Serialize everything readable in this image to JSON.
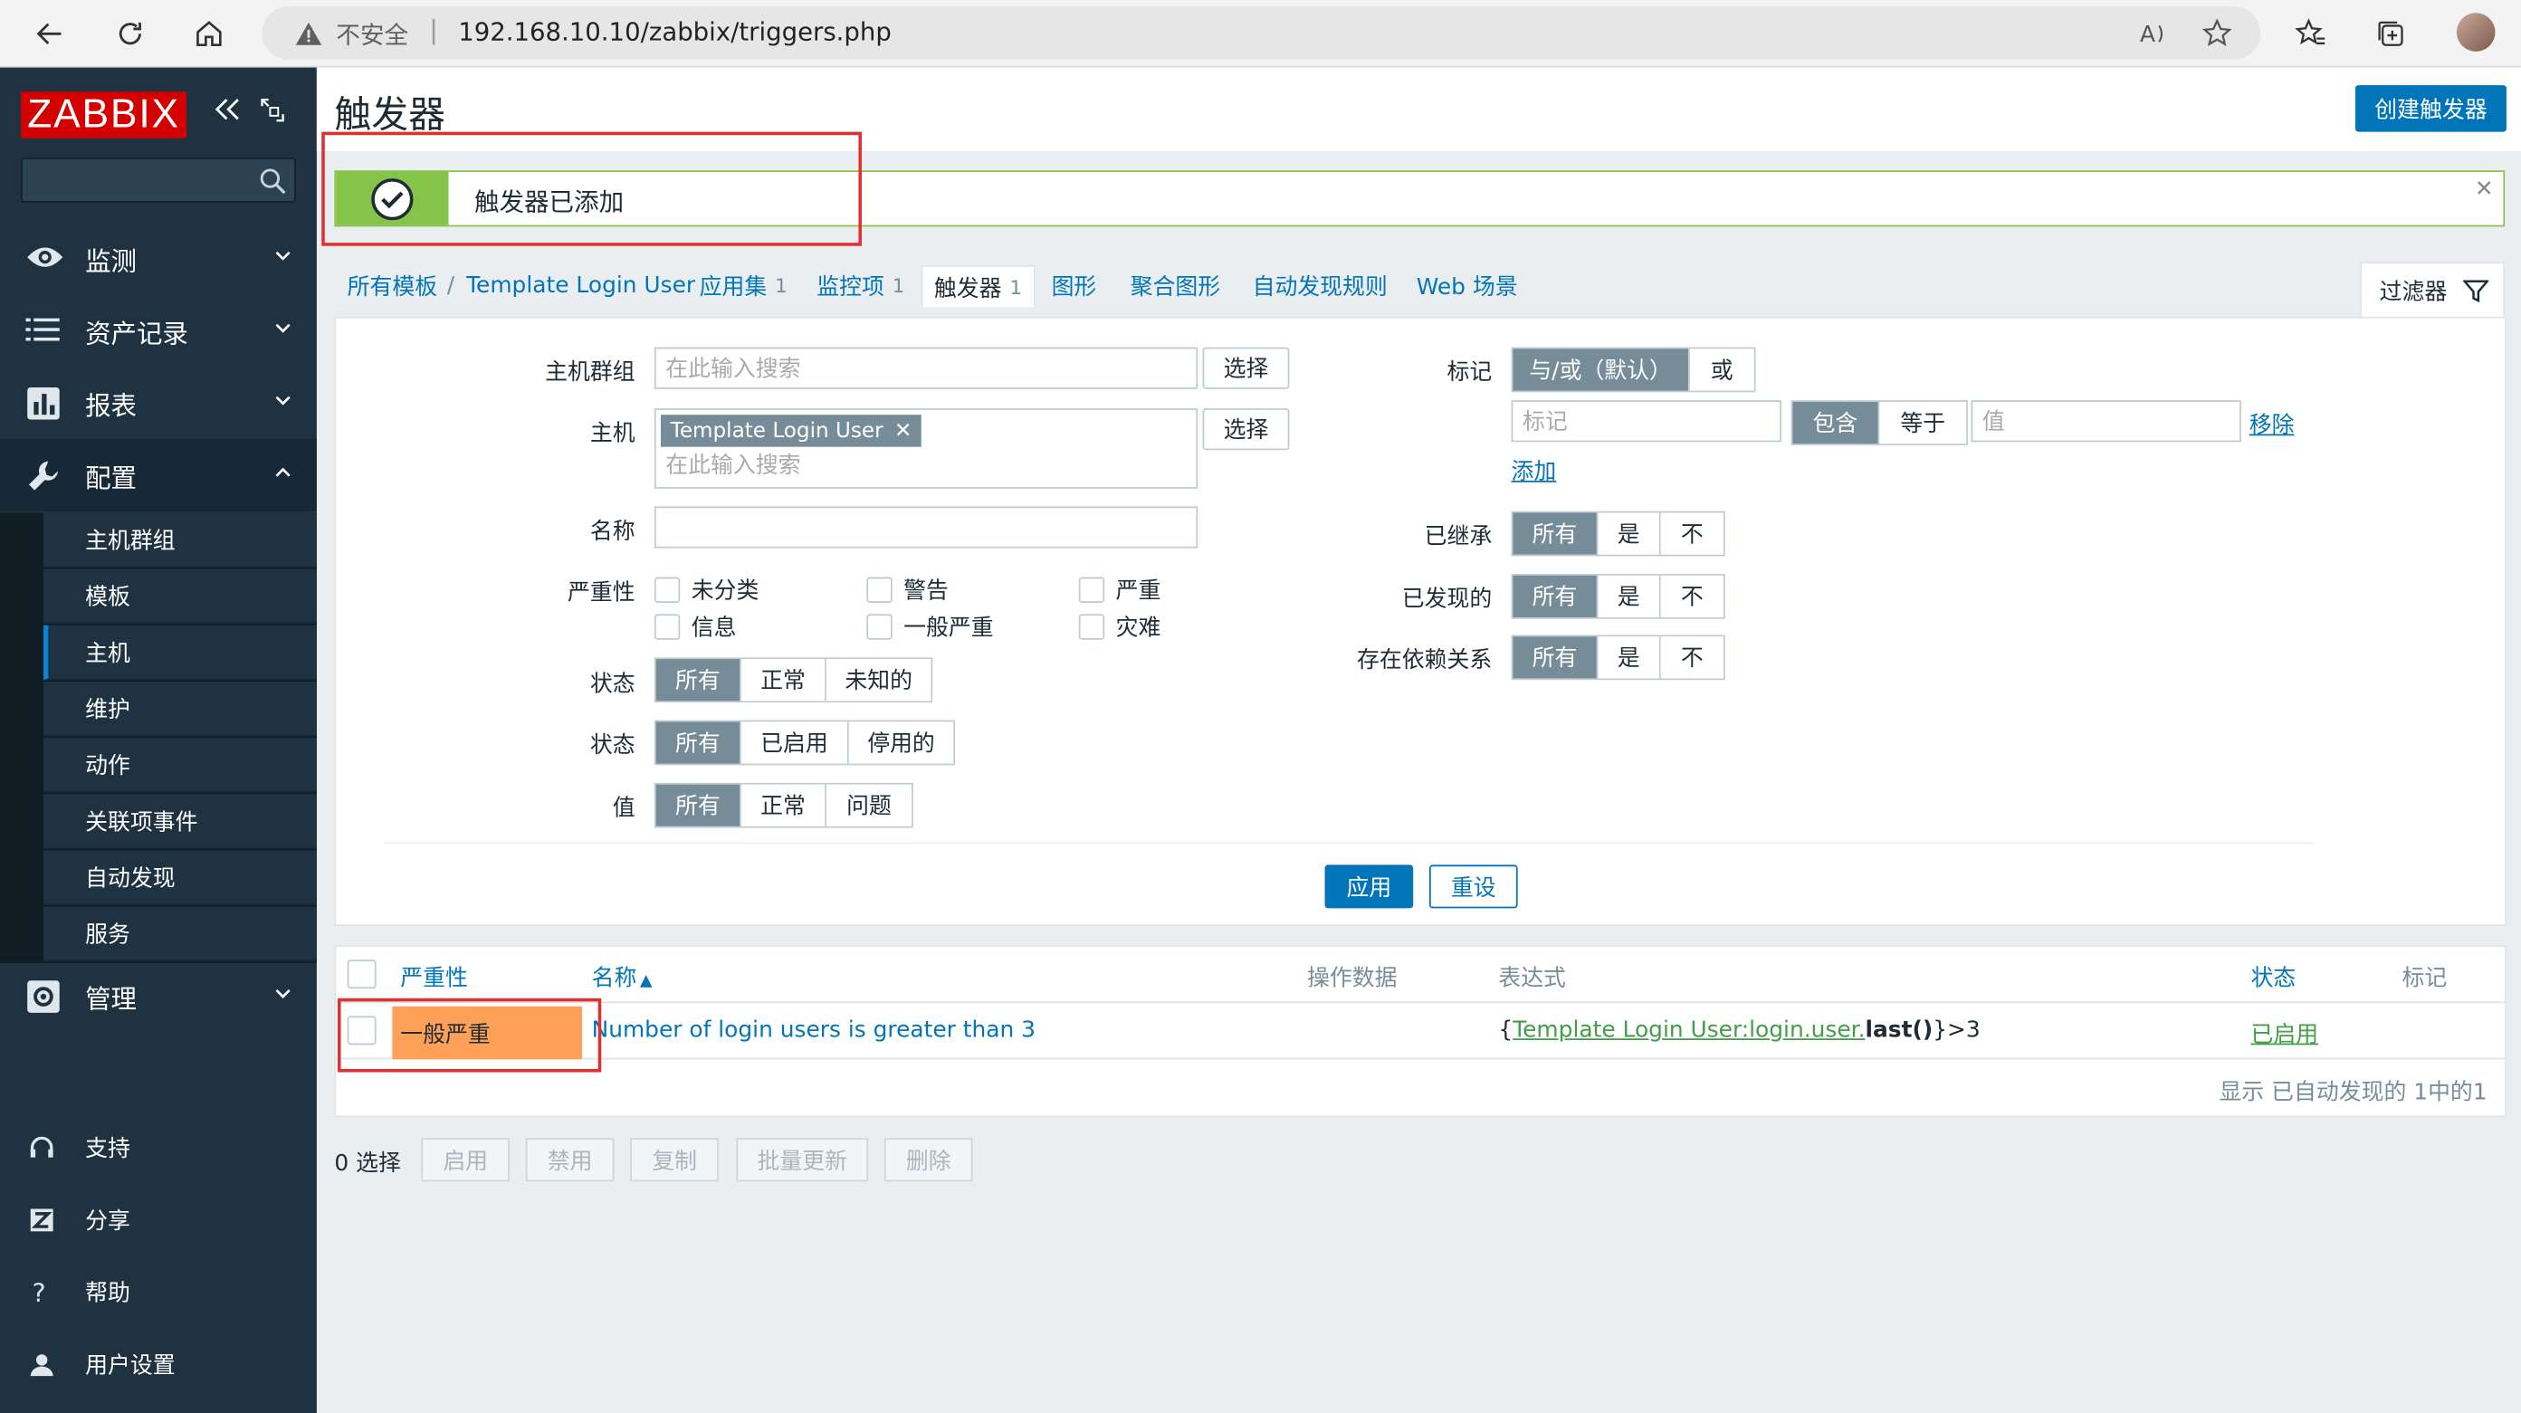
{
  "browser": {
    "insecure_label": "不安全",
    "url": "192.168.10.10/zabbix/triggers.php"
  },
  "sidebar": {
    "logo": "ZABBIX",
    "search_placeholder": "",
    "menu": [
      {
        "label": "监测",
        "icon": "eye-icon"
      },
      {
        "label": "资产记录",
        "icon": "list-icon"
      },
      {
        "label": "报表",
        "icon": "chart-icon"
      },
      {
        "label": "配置",
        "icon": "wrench-icon"
      }
    ],
    "config_items": [
      "主机群组",
      "模板",
      "主机",
      "维护",
      "动作",
      "关联项事件",
      "自动发现",
      "服务"
    ],
    "admin_label": "管理",
    "bottom": [
      {
        "label": "支持",
        "icon": "headset-icon"
      },
      {
        "label": "分享",
        "icon": "share-icon"
      },
      {
        "label": "帮助",
        "icon": "help-icon"
      },
      {
        "label": "用户设置",
        "icon": "user-icon"
      }
    ]
  },
  "header": {
    "title": "触发器",
    "create_button": "创建触发器"
  },
  "message": {
    "text": "触发器已添加"
  },
  "breadcrumbs": {
    "all_templates": "所有模板",
    "separator": "/",
    "template": "Template Login User",
    "tabs": [
      {
        "label": "应用集",
        "count": "1"
      },
      {
        "label": "监控项",
        "count": "1"
      },
      {
        "label": "触发器",
        "count": "1"
      },
      {
        "label": "图形",
        "count": ""
      },
      {
        "label": "聚合图形",
        "count": ""
      },
      {
        "label": "自动发现规则",
        "count": ""
      },
      {
        "label": "Web 场景",
        "count": ""
      }
    ],
    "filter_label": "过滤器"
  },
  "filter": {
    "host_group_label": "主机群组",
    "host_group_placeholder": "在此输入搜索",
    "select_label": "选择",
    "host_label": "主机",
    "host_chip": "Template Login User",
    "host_placeholder": "在此输入搜索",
    "name_label": "名称",
    "severity_label": "严重性",
    "severities": [
      "未分类",
      "警告",
      "严重",
      "信息",
      "一般严重",
      "灾难"
    ],
    "state_label": "状态",
    "state_options": [
      "所有",
      "正常",
      "未知的"
    ],
    "status_label": "状态",
    "status_options": [
      "所有",
      "已启用",
      "停用的"
    ],
    "value_label": "值",
    "value_options": [
      "所有",
      "正常",
      "问题"
    ],
    "tags_label": "标记",
    "tag_eval": [
      "与/或（默认）",
      "或"
    ],
    "tag_placeholder": "标记",
    "tag_ops": [
      "包含",
      "等于"
    ],
    "value_placeholder": "值",
    "remove_link": "移除",
    "add_link": "添加",
    "inherited_label": "已继承",
    "discovered_label": "已发现的",
    "depends_label": "存在依赖关系",
    "tri_options": [
      "所有",
      "是",
      "不"
    ],
    "apply_label": "应用",
    "reset_label": "重设"
  },
  "table": {
    "columns": {
      "severity": "严重性",
      "name": "名称",
      "sort_arrow": "▲",
      "operational": "操作数据",
      "expression": "表达式",
      "status": "状态",
      "tags": "标记"
    },
    "rows": [
      {
        "severity": "一般严重",
        "name": "Number of login users is greater than 3",
        "expr_open": "{",
        "expr_host_item": "Template Login User:login.user.",
        "expr_func": "last()",
        "expr_close": "}>3",
        "status": "已启用"
      }
    ],
    "footer": "显示 已自动发现的 1中的1"
  },
  "actions": {
    "selected": "0 选择",
    "buttons": [
      "启用",
      "禁用",
      "复制",
      "批量更新",
      "删除"
    ]
  },
  "colors": {
    "brand": "#d40000",
    "link": "#0275b8",
    "success": "#86c34b",
    "severity_average": "#ffa059",
    "highlight": "#e03131"
  }
}
